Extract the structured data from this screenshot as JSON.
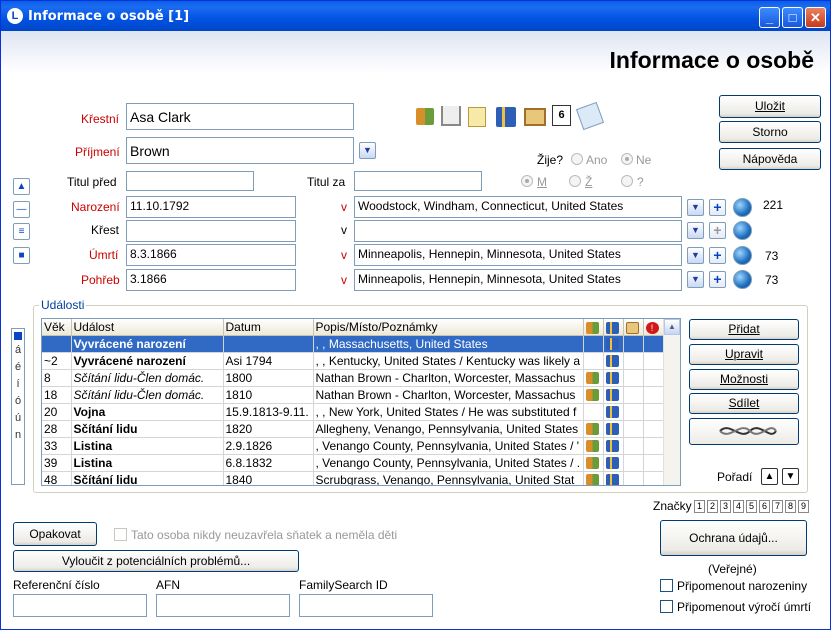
{
  "window": {
    "title": "Informace o osobě  [1]",
    "header": "Informace o osobě",
    "min": "_",
    "max": "□",
    "close": "✕"
  },
  "form": {
    "given_label": "Křestní",
    "given": "Asa Clark",
    "surname_label": "Příjmení",
    "surname": "Brown",
    "title_before_label": "Titul před",
    "title_before": "",
    "title_after_label": "Titul za",
    "title_after": "",
    "alive_label": "Žije?",
    "alive_yes": "Ano",
    "alive_no": "Ne",
    "sex_m": "M",
    "sex_f": "Ž",
    "sex_unknown": "?",
    "birth_label": "Narození",
    "birth_date": "11.10.1792",
    "birth_place": "Woodstock, Windham, Connecticut, United States",
    "birth_count": "221",
    "christening_label": "Křest",
    "christening_date": "",
    "christening_place": "",
    "death_label": "Úmrtí",
    "death_date": "8.3.1866",
    "death_place": "Minneapolis, Hennepin, Minnesota, United States",
    "death_count": "73",
    "burial_label": "Pohřeb",
    "burial_date": "3.1866",
    "burial_place": "Minneapolis, Hennepin, Minnesota, United States",
    "burial_count": "73",
    "v": "v"
  },
  "buttons": {
    "save": "Uložit",
    "cancel": "Storno",
    "help": "Nápověda",
    "add": "Přidat",
    "edit": "Upravit",
    "options": "Možnosti",
    "share": "Sdílet",
    "order": "Pořadí",
    "repeat": "Opakovat",
    "exclude": "Vyloučit z potenciálních problémů...",
    "privacy": "Ochrana údajů...",
    "privacy_state": "(Veřejné)"
  },
  "events": {
    "title": "Události",
    "columns": [
      "Věk",
      "Událost",
      "Datum",
      "Popis/Místo/Poznámky"
    ],
    "side_label": [
      "á",
      "é",
      "í",
      "ó",
      "ú",
      "n"
    ],
    "rows": [
      {
        "age": "",
        "event": "Vyvrácené narození",
        "date": "",
        "place": ", , Massachusetts, United States",
        "icons": "book"
      },
      {
        "age": "~2",
        "event": "Vyvrácené narození",
        "date": "Asi 1794",
        "place": ", , Kentucky, United States / Kentucky was likely a",
        "icons": "book"
      },
      {
        "age": "8",
        "event": "Sčítání lidu-Člen domác.",
        "date": "1800",
        "place": "Nathan Brown - Charlton, Worcester, Massachus",
        "icons": "people book"
      },
      {
        "age": "18",
        "event": "Sčítání lidu-Člen domác.",
        "date": "1810",
        "place": "Nathan Brown - Charlton, Worcester, Massachus",
        "icons": "people book"
      },
      {
        "age": "20",
        "event": "Vojna",
        "date": "15.9.1813-9.11.",
        "place": ", , New York, United States / He was substituted f",
        "icons": "book"
      },
      {
        "age": "28",
        "event": "Sčítání lidu",
        "date": "1820",
        "place": "Allegheny, Venango, Pennsylvania, United States",
        "icons": "people book"
      },
      {
        "age": "33",
        "event": "Listina",
        "date": "2.9.1826",
        "place": ", Venango County, Pennsylvania, United States / '",
        "icons": "people book"
      },
      {
        "age": "39",
        "event": "Listina",
        "date": "6.8.1832",
        "place": ", Venango County, Pennsylvania, United States / .",
        "icons": "people book"
      },
      {
        "age": "48",
        "event": "Sčítání lidu",
        "date": "1840",
        "place": "Scrubgrass, Venango, Pennsylvania, United Stat",
        "icons": "people book"
      }
    ]
  },
  "marks": {
    "label": "Značky",
    "items": [
      "1",
      "2",
      "3",
      "4",
      "5",
      "6",
      "7",
      "8",
      "9"
    ]
  },
  "never_married": "Tato osoba nikdy neuzavřela sňatek a neměla děti",
  "ref_label": "Referenční číslo",
  "afn_label": "AFN",
  "fs_label": "FamilySearch ID",
  "remind_birth": "Připomenout narozeniny",
  "remind_death": "Připomenout výročí úmrtí"
}
